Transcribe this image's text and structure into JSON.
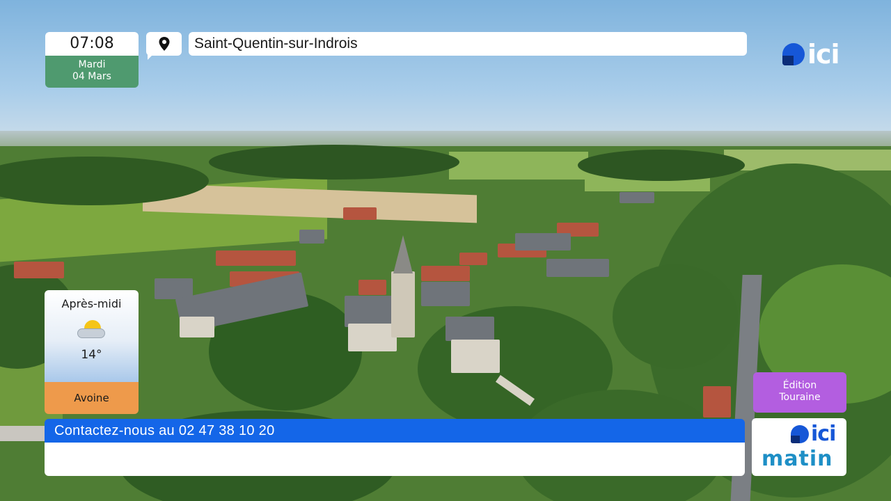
{
  "clock": {
    "time": "07:08",
    "day": "Mardi",
    "date": "04 Mars"
  },
  "location": {
    "icon": "map-pin-icon",
    "name": "Saint-Quentin-sur-Indrois"
  },
  "brand": {
    "logo_text": "ici",
    "show_logo_text": "ici",
    "show_name": "matin",
    "accent_color": "#1657d7"
  },
  "weather": {
    "period": "Après-midi",
    "icon": "sun-behind-cloud-icon",
    "temperature": "14°",
    "place": "Avoine"
  },
  "edition": {
    "line1": "Édition",
    "line2": "Touraine",
    "color": "#b35ee0"
  },
  "contact": {
    "text": "Contactez-nous au 02 47 38 10 20",
    "color": "#1466e8"
  }
}
